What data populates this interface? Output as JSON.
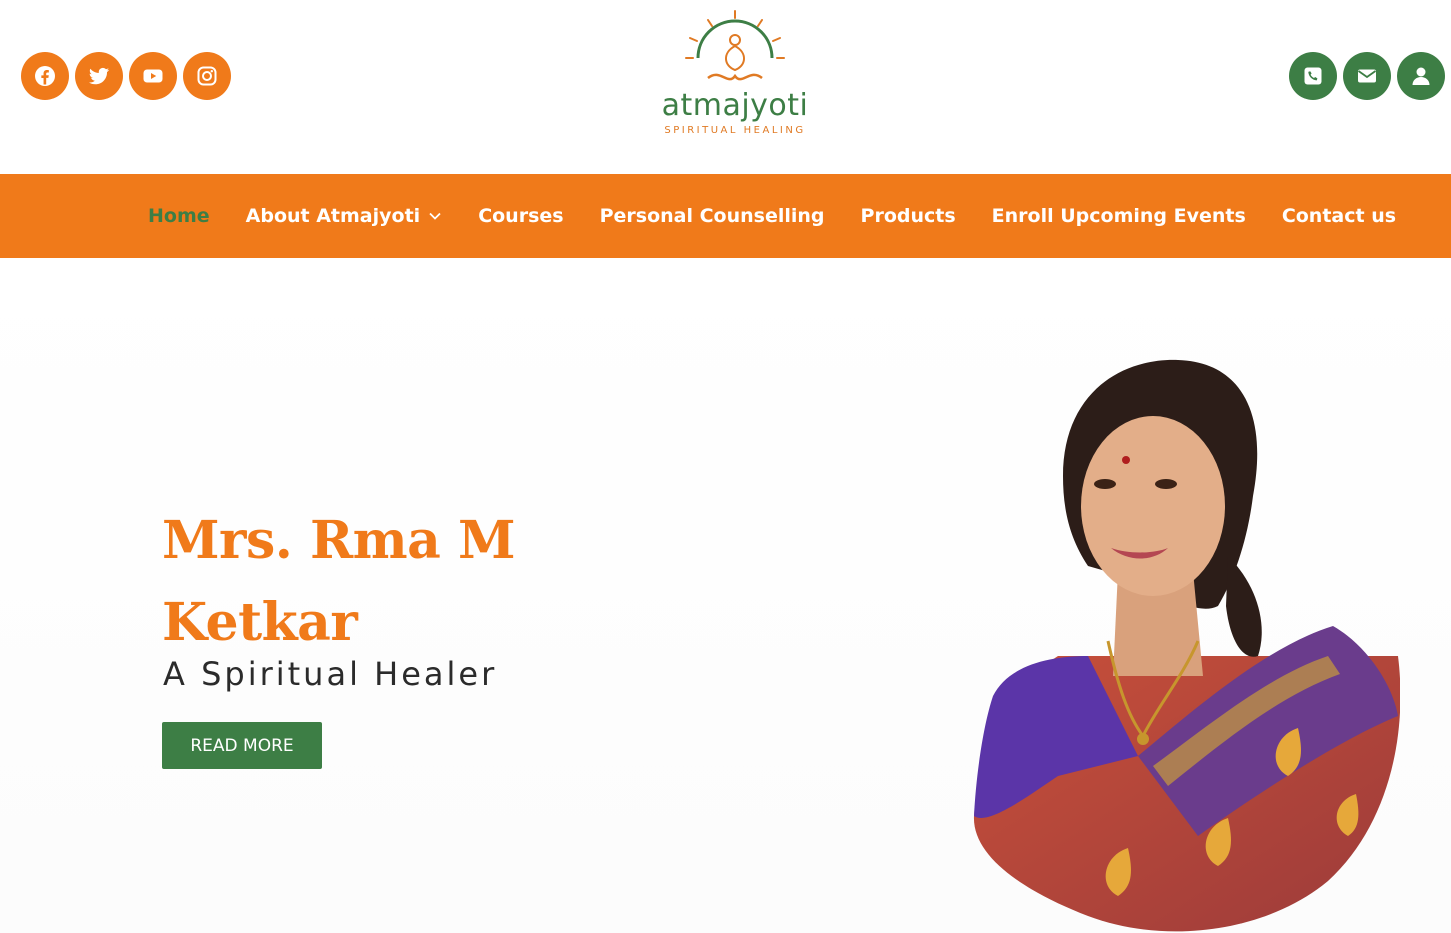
{
  "brand": {
    "name": "atmajyoti",
    "subtitle": "SPIRITUAL HEALING",
    "colors": {
      "orange": "#f07a1a",
      "green": "#3d7e45"
    }
  },
  "header": {
    "social_icons": [
      "facebook-icon",
      "twitter-icon",
      "youtube-icon",
      "instagram-icon"
    ],
    "contact_icons": [
      "phone-icon",
      "email-icon",
      "user-icon"
    ]
  },
  "nav": {
    "items": [
      {
        "label": "Home",
        "active": true
      },
      {
        "label": "About Atmajyoti",
        "has_dropdown": true
      },
      {
        "label": "Courses"
      },
      {
        "label": "Personal Counselling"
      },
      {
        "label": "Products"
      },
      {
        "label": "Enroll Upcoming Events"
      },
      {
        "label": "Contact us"
      }
    ]
  },
  "hero": {
    "name": "Mrs. Rma M Ketkar",
    "tagline": "A Spiritual Healer",
    "button_label": "READ MORE"
  }
}
